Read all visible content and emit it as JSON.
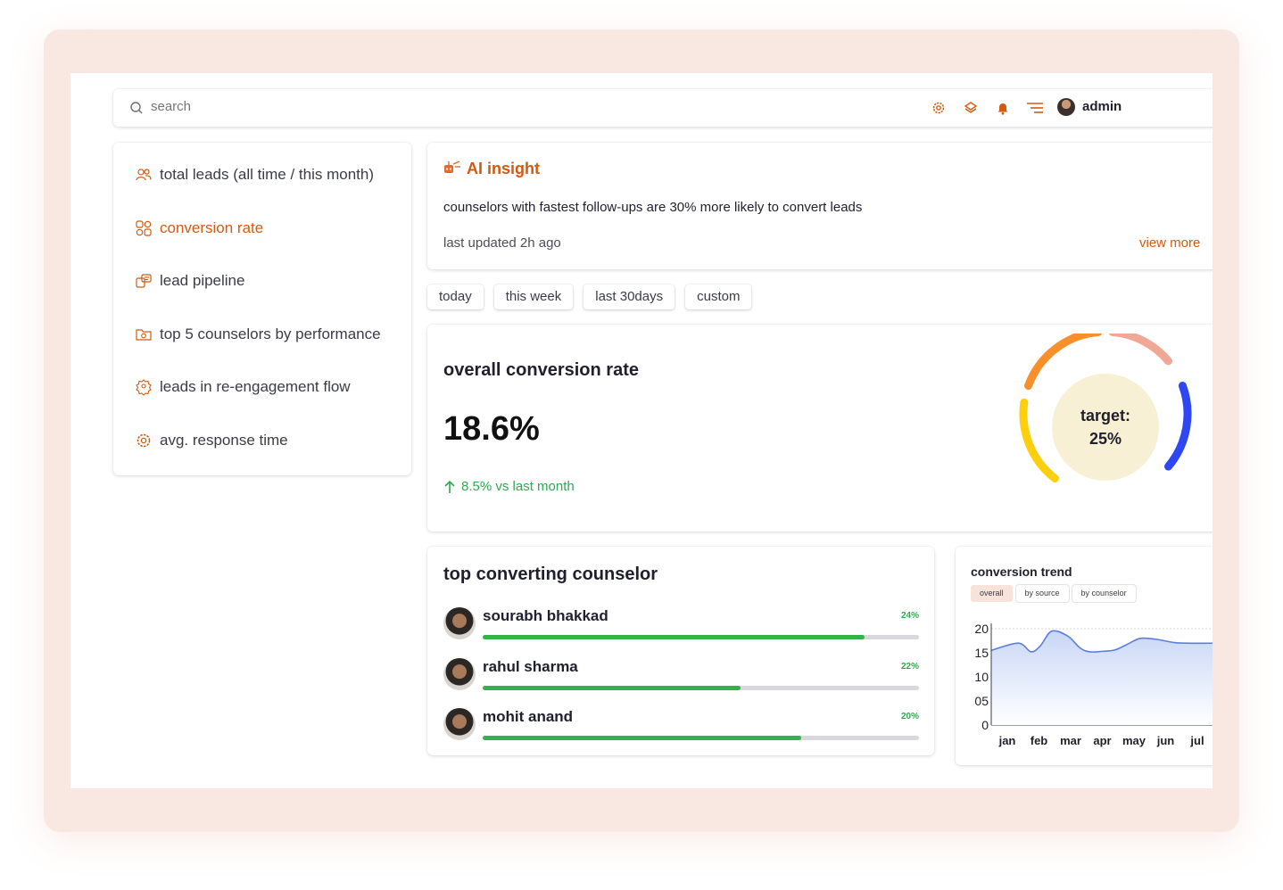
{
  "search": {
    "placeholder": "search"
  },
  "topbar": {
    "icons": [
      "gear-icon",
      "layers-icon",
      "bell-icon",
      "menu-icon"
    ],
    "user": "admin"
  },
  "sidebar": {
    "items": [
      {
        "label": "total leads (all time / this month)",
        "icon": "users-icon",
        "active": false
      },
      {
        "label": "conversion rate",
        "icon": "conversion-icon",
        "active": true
      },
      {
        "label": "lead pipeline",
        "icon": "pipeline-icon",
        "active": false
      },
      {
        "label": "top 5 counselors by performance",
        "icon": "folder-icon",
        "active": false
      },
      {
        "label": "leads in re-engagement flow",
        "icon": "badge-icon",
        "active": false
      },
      {
        "label": "avg. response time",
        "icon": "gear-icon",
        "active": false
      }
    ]
  },
  "ai_insight": {
    "title": "AI insight",
    "text": "counselors with fastest follow-ups are 30%  more likely to convert leads",
    "updated": "last updated 2h ago",
    "link": "view more"
  },
  "filters": [
    "today",
    "this week",
    "last 30days",
    "custom"
  ],
  "conversion": {
    "title": "overall conversion rate",
    "value": "18.6%",
    "delta": "8.5% vs last month",
    "target_label": "target:",
    "target_value": "25%",
    "gauge_colors": [
      "#fbcf0e",
      "#f7902a",
      "#f0a793",
      "#2f47f2"
    ]
  },
  "counselors": {
    "title": "top converting counselor",
    "items": [
      {
        "name": "sourabh bhakkad",
        "pct_label": "24%",
        "progress": 0.875
      },
      {
        "name": "rahul sharma",
        "pct_label": "22%",
        "progress": 0.59
      },
      {
        "name": "mohit anand",
        "pct_label": "20%",
        "progress": 0.73
      }
    ]
  },
  "trend": {
    "title": "conversion trend",
    "tabs": [
      "overall",
      "by source",
      "by counselor"
    ],
    "active_tab": 0
  },
  "chart_data": {
    "type": "area",
    "title": "conversion trend",
    "categories": [
      "jan",
      "feb",
      "mar",
      "apr",
      "may",
      "jun",
      "jul"
    ],
    "y_ticks": [
      "20",
      "15",
      "10",
      "05",
      "0"
    ],
    "ylim": [
      0,
      20
    ],
    "x": [
      0,
      0.35,
      0.75,
      1.05,
      1.4,
      1.9,
      2.3,
      2.6,
      3.0,
      3.4,
      3.8,
      4.2,
      4.7,
      5.2,
      5.6,
      6.0
    ],
    "values": [
      15.5,
      17.0,
      15.2,
      16.5,
      19.5,
      18.5,
      16.0,
      15.2,
      15.3,
      15.6,
      16.8,
      18.0,
      17.8,
      17.2,
      17.0,
      17.0
    ],
    "colors": {
      "line": "#5b7fe0",
      "fill_top": "#c9d6f6",
      "fill_bottom": "#ffffff"
    }
  }
}
